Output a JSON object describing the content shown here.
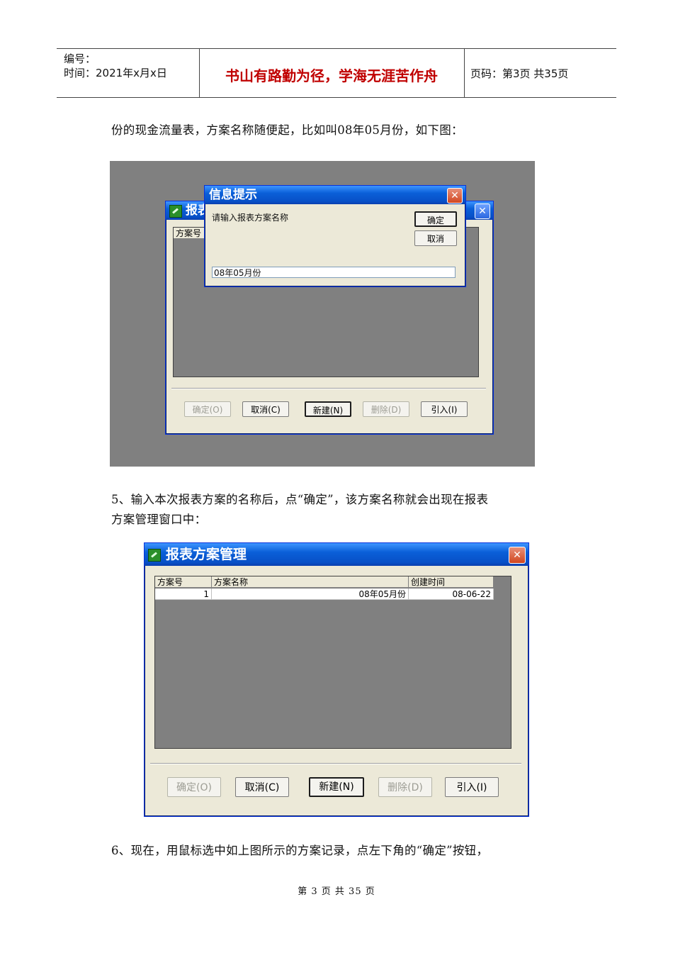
{
  "header": {
    "number_label": "编号：",
    "date_label": "时间：2021年x月x日",
    "motto": "书山有路勤为径，学海无涯苦作舟",
    "page_info": "页码：第3页  共35页"
  },
  "paragraphs": {
    "p1": "份的现金流量表，方案名称随便起，比如叫08年05月份，如下图：",
    "p2_line1": "5、输入本次报表方案的名称后，点“确定”，该方案名称就会出现在报表",
    "p2_line2": "方案管理窗口中：",
    "p3": "6、现在，用鼠标选中如上图所示的方案记录，点左下角的“确定”按钮，"
  },
  "shot1": {
    "bg_window_title": "报表",
    "column_header": "方案号",
    "dialog": {
      "title": "信息提示",
      "prompt": "请输入报表方案名称",
      "ok": "确定",
      "cancel": "取消",
      "input_value": "08年05月份"
    },
    "buttons": {
      "ok": "确定(O)",
      "cancel": "取消(C)",
      "new": "新建(N)",
      "delete": "删除(D)",
      "import": "引入(I)"
    }
  },
  "shot2": {
    "title": "报表方案管理",
    "columns": [
      "方案号",
      "方案名称",
      "创建时间"
    ],
    "rows": [
      {
        "id": "1",
        "name": "08年05月份",
        "created": "08-06-22"
      }
    ],
    "buttons": {
      "ok": "确定(O)",
      "cancel": "取消(C)",
      "new": "新建(N)",
      "delete": "删除(D)",
      "import": "引入(I)"
    }
  },
  "footer": "第 3 页 共 35 页",
  "icons": {
    "close": "close-icon",
    "app": "app-icon"
  },
  "colors": {
    "motto": "#c00000",
    "titlebar": "#0a5fd8",
    "close": "#d2461f",
    "desktop": "#808080"
  }
}
